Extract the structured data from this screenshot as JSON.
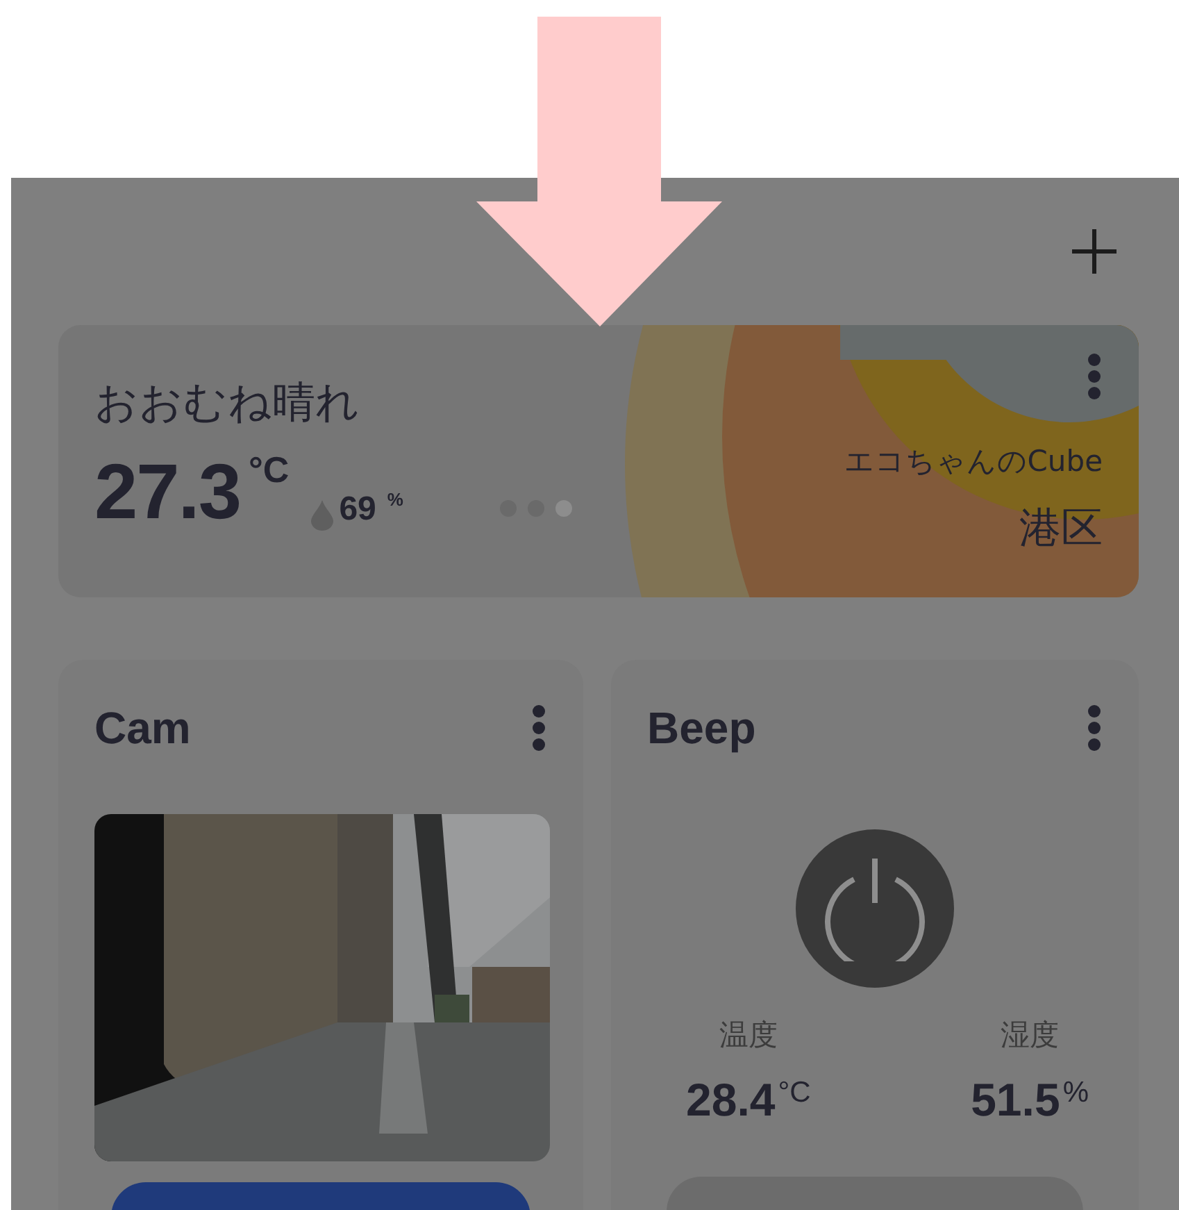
{
  "weather": {
    "condition": "おおむね晴れ",
    "temperature": "27.3",
    "temperature_unit": "°C",
    "humidity": "69",
    "humidity_unit": "%",
    "device": "エコちゃんのCube",
    "location": "港区",
    "pages": [
      {
        "selected": false
      },
      {
        "selected": false
      },
      {
        "selected": true
      }
    ]
  },
  "devices": [
    {
      "kind": "camera",
      "title": "Cam"
    },
    {
      "kind": "sensor",
      "title": "Beep",
      "readings": [
        {
          "label": "温度",
          "value": "28.4",
          "unit": "°C"
        },
        {
          "label": "湿度",
          "value": "51.5",
          "unit": "%"
        }
      ]
    }
  ]
}
